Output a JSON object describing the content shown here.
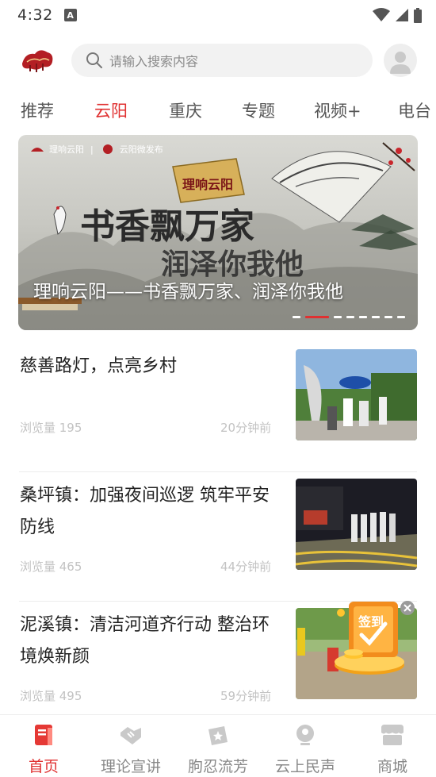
{
  "status_bar": {
    "time": "4:32",
    "notification_glyph": "A"
  },
  "search": {
    "placeholder": "请输入搜索内容"
  },
  "tabs": [
    {
      "label": "推荐",
      "active": false
    },
    {
      "label": "云阳",
      "active": true
    },
    {
      "label": "重庆",
      "active": false
    },
    {
      "label": "专题",
      "active": false
    },
    {
      "label": "视频+",
      "active": false
    },
    {
      "label": "电台",
      "active": false
    }
  ],
  "banner": {
    "caption": "理响云阳——书香飘万家、润泽你我他",
    "brand_left": "理响云阳",
    "brand_right": "云阳微发布",
    "headline_line1": "书香飘万家",
    "headline_line2": "润泽你我他",
    "seal_text": "理响云阳",
    "dot_count": 8,
    "active_dot": 1
  },
  "news": [
    {
      "title": "慈善路灯，点亮乡村",
      "views": "浏览量 195",
      "time": "20分钟前"
    },
    {
      "title": "桑坪镇：加强夜间巡逻  筑牢平安防线",
      "views": "浏览量 465",
      "time": "44分钟前"
    },
    {
      "title": "泥溪镇：清洁河道齐行动 整治环境焕新颜",
      "views": "浏览量 495",
      "time": "59分钟前"
    }
  ],
  "signin": {
    "label": "签到"
  },
  "bottom_nav": [
    {
      "label": "首页",
      "icon": "home-icon",
      "active": true
    },
    {
      "label": "理论宣讲",
      "icon": "handshake-icon",
      "active": false
    },
    {
      "label": "朐忍流芳",
      "icon": "ticket-star-icon",
      "active": false
    },
    {
      "label": "云上民声",
      "icon": "user-voice-icon",
      "active": false
    },
    {
      "label": "商城",
      "icon": "shop-icon",
      "active": false
    }
  ],
  "colors": {
    "accent": "#e03131",
    "muted_text": "#c3c3c3",
    "nav_inactive": "#888888"
  }
}
